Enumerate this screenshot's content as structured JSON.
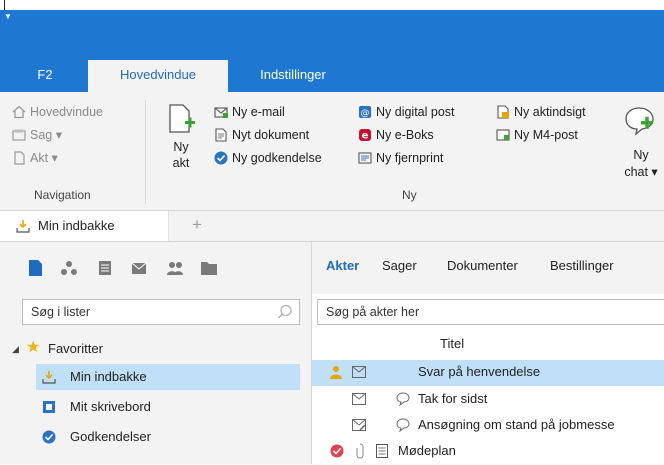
{
  "ribbon_tabs": [
    {
      "label": "F2"
    },
    {
      "label": "Hovedvindue"
    },
    {
      "label": "Indstillinger"
    }
  ],
  "navigation": {
    "items": [
      {
        "label": "Hovedvindue"
      },
      {
        "label": "Sag ▾"
      },
      {
        "label": "Akt ▾"
      }
    ],
    "group_label": "Navigation"
  },
  "new_group": {
    "new_akt_label_1": "Ny",
    "new_akt_label_2": "akt",
    "col1": [
      {
        "label": "Ny e-mail"
      },
      {
        "label": "Nyt dokument"
      },
      {
        "label": "Ny godkendelse"
      }
    ],
    "col2": [
      {
        "label": "Ny digital post"
      },
      {
        "label": "Ny e-Boks"
      },
      {
        "label": "Ny fjernprint"
      }
    ],
    "col3": [
      {
        "label": "Ny aktindsigt"
      },
      {
        "label": "Ny M4-post"
      }
    ],
    "chat_label_1": "Ny",
    "chat_label_2": "chat ▾",
    "group_label": "Ny"
  },
  "doc_tabs": {
    "active": "Min indbakke",
    "add": "+"
  },
  "left": {
    "search_placeholder": "Søg i lister",
    "tree": [
      {
        "label": "Favoritter"
      },
      {
        "label": "Min indbakke"
      },
      {
        "label": "Mit skrivebord"
      },
      {
        "label": "Godkendelser"
      }
    ]
  },
  "right": {
    "tabs": [
      {
        "label": "Akter"
      },
      {
        "label": "Sager"
      },
      {
        "label": "Dokumenter"
      },
      {
        "label": "Bestillinger"
      }
    ],
    "search_placeholder": "Søg på akter her",
    "column_title": "Titel",
    "rows": [
      {
        "title": "Svar på henvendelse"
      },
      {
        "title": "Tak for sidst"
      },
      {
        "title": "Ansøgning om stand på jobmesse"
      },
      {
        "title": "Mødeplan"
      }
    ]
  },
  "colors": {
    "accent": "#1e78d2",
    "selection": "#bfe0f7",
    "ribbon_bg": "#f3f3f3"
  }
}
